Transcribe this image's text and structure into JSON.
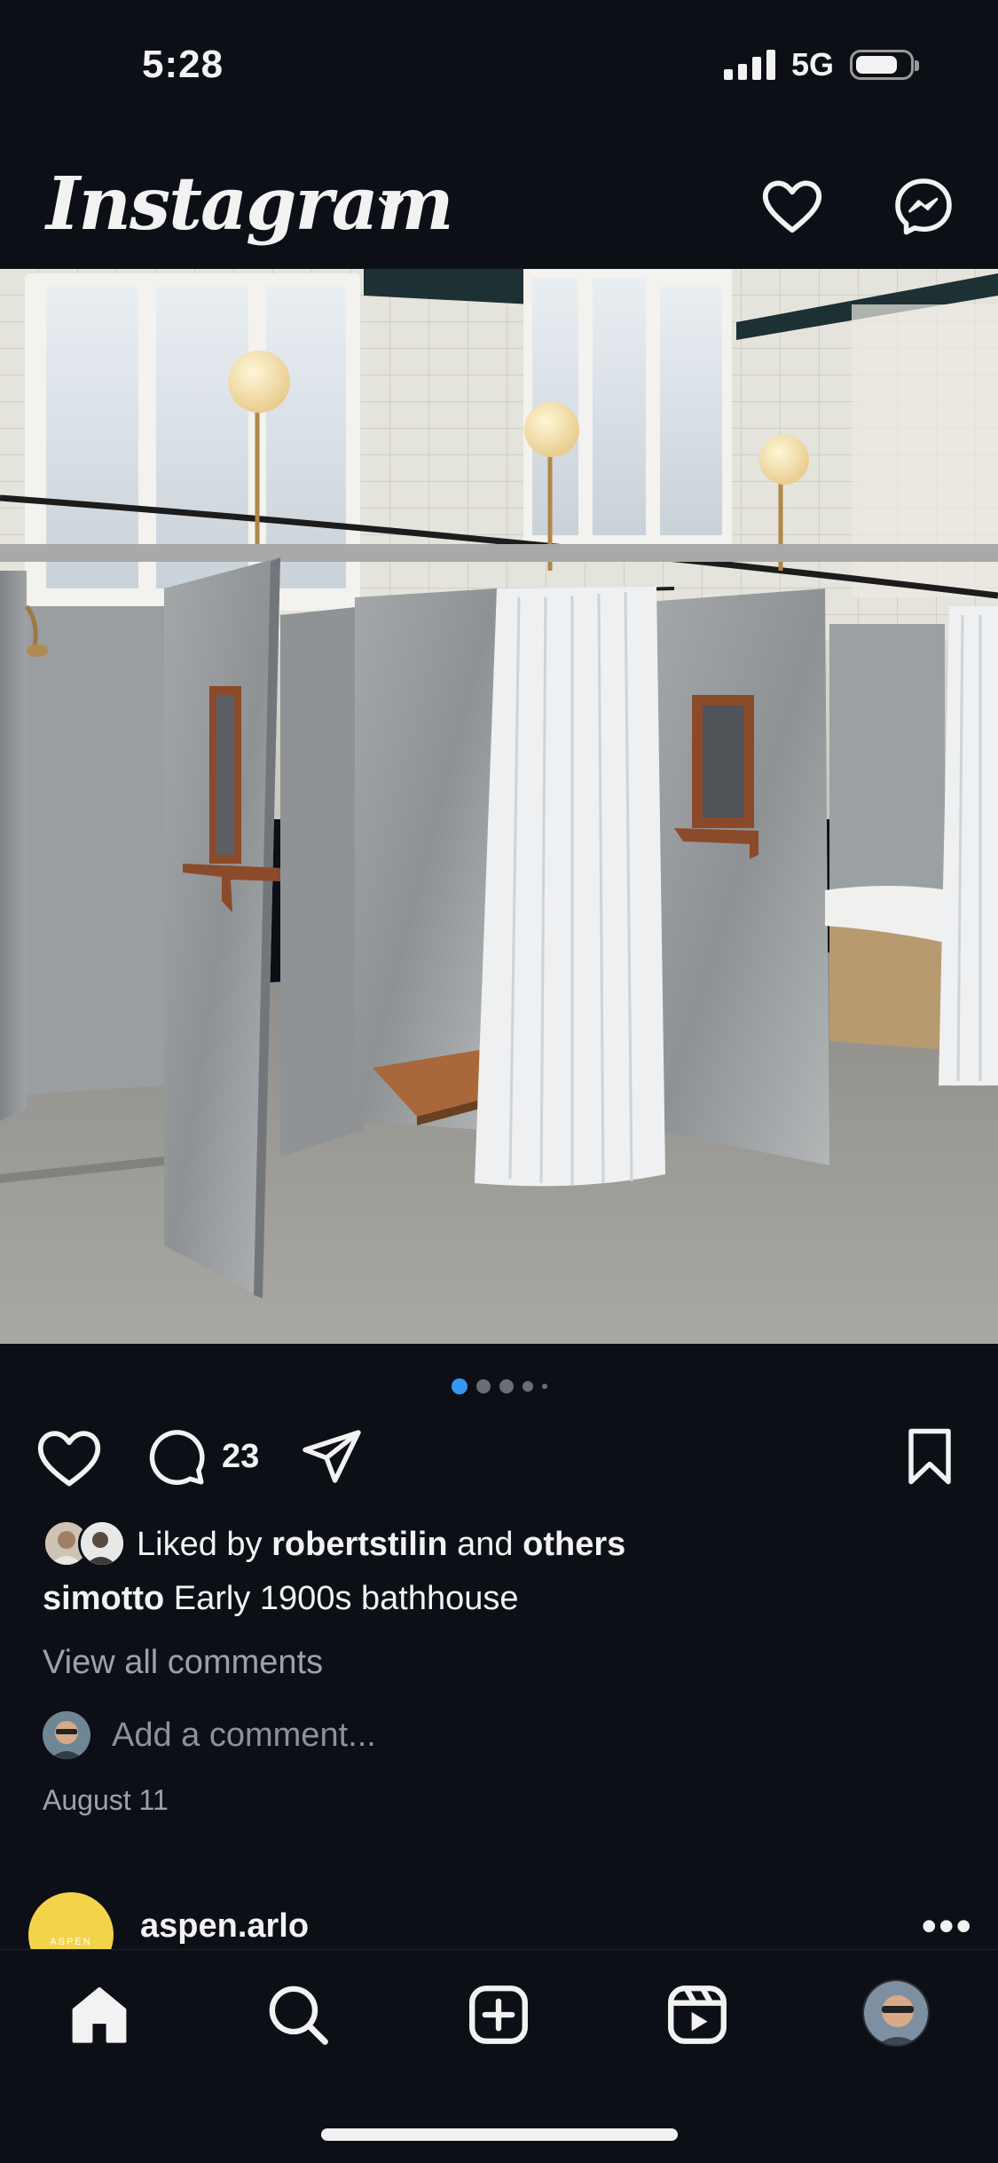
{
  "status_bar": {
    "time": "5:28",
    "network": "5G",
    "battery_level": 0.8
  },
  "header": {
    "logo": "Instagram",
    "icons": [
      "chevron-down-icon",
      "heart-icon",
      "messenger-icon"
    ]
  },
  "post": {
    "carousel": {
      "count": 5,
      "active_index": 0
    },
    "comment_count": "23",
    "likes": {
      "prefix": "Liked by",
      "user": "robertstilin",
      "connector": "and",
      "others": "others"
    },
    "caption": {
      "username": "simotto",
      "text": "Early 1900s bathhouse"
    },
    "view_comments": "View all comments",
    "add_comment_placeholder": "Add a comment...",
    "date": "August 11"
  },
  "next_post": {
    "username": "aspen.arlo",
    "avatar_text": "ASPEN KARLO",
    "avatar_color": "#f3d34a"
  },
  "tab_bar": {
    "items": [
      "home-icon",
      "search-icon",
      "create-icon",
      "reels-icon",
      "profile-avatar"
    ]
  },
  "colors": {
    "background": "#0c0f16",
    "accent": "#3897f0"
  }
}
